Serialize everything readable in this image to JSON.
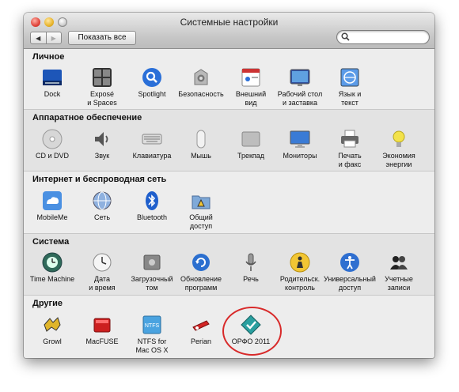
{
  "window": {
    "title": "Системные настройки"
  },
  "toolbar": {
    "back": "◀",
    "forward": "▶",
    "show_all": "Показать все",
    "search_placeholder": ""
  },
  "sections": [
    {
      "title": "Личное",
      "items": [
        {
          "label": "Dock",
          "icon": "dock-icon"
        },
        {
          "label": "Exposé\nи Spaces",
          "icon": "expose-icon"
        },
        {
          "label": "Spotlight",
          "icon": "spotlight-icon"
        },
        {
          "label": "Безопасность",
          "icon": "security-icon"
        },
        {
          "label": "Внешний\nвид",
          "icon": "appearance-icon"
        },
        {
          "label": "Рабочий стол\nи заставка",
          "icon": "desktop-icon"
        },
        {
          "label": "Язык и\nтекст",
          "icon": "language-icon"
        }
      ]
    },
    {
      "title": "Аппаратное обеспечение",
      "items": [
        {
          "label": "CD и DVD",
          "icon": "cd-icon"
        },
        {
          "label": "Звук",
          "icon": "sound-icon"
        },
        {
          "label": "Клавиатура",
          "icon": "keyboard-icon"
        },
        {
          "label": "Мышь",
          "icon": "mouse-icon"
        },
        {
          "label": "Трекпад",
          "icon": "trackpad-icon"
        },
        {
          "label": "Мониторы",
          "icon": "monitor-icon"
        },
        {
          "label": "Печать\nи факс",
          "icon": "printer-icon"
        },
        {
          "label": "Экономия\nэнергии",
          "icon": "energy-icon"
        }
      ]
    },
    {
      "title": "Интернет и беспроводная сеть",
      "items": [
        {
          "label": "MobileMe",
          "icon": "mobileme-icon"
        },
        {
          "label": "Сеть",
          "icon": "network-icon"
        },
        {
          "label": "Bluetooth",
          "icon": "bluetooth-icon"
        },
        {
          "label": "Общий\nдоступ",
          "icon": "sharing-icon"
        }
      ]
    },
    {
      "title": "Система",
      "items": [
        {
          "label": "Time Machine",
          "icon": "time-machine-icon"
        },
        {
          "label": "Дата\nи время",
          "icon": "date-time-icon"
        },
        {
          "label": "Загрузочный\nтом",
          "icon": "startup-disk-icon"
        },
        {
          "label": "Обновление\nпрограмм",
          "icon": "software-update-icon"
        },
        {
          "label": "Речь",
          "icon": "speech-icon"
        },
        {
          "label": "Родительск.\nконтроль",
          "icon": "parental-icon"
        },
        {
          "label": "Универсальный\nдоступ",
          "icon": "accessibility-icon"
        },
        {
          "label": "Учетные\nзаписи",
          "icon": "accounts-icon"
        }
      ]
    },
    {
      "title": "Другие",
      "items": [
        {
          "label": "Growl",
          "icon": "growl-icon"
        },
        {
          "label": "MacFUSE",
          "icon": "macfuse-icon"
        },
        {
          "label": "NTFS for\nMac OS X",
          "icon": "ntfs-icon"
        },
        {
          "label": "Perian",
          "icon": "perian-icon"
        },
        {
          "label": "ОРФО 2011",
          "icon": "orfo-icon"
        }
      ]
    }
  ]
}
